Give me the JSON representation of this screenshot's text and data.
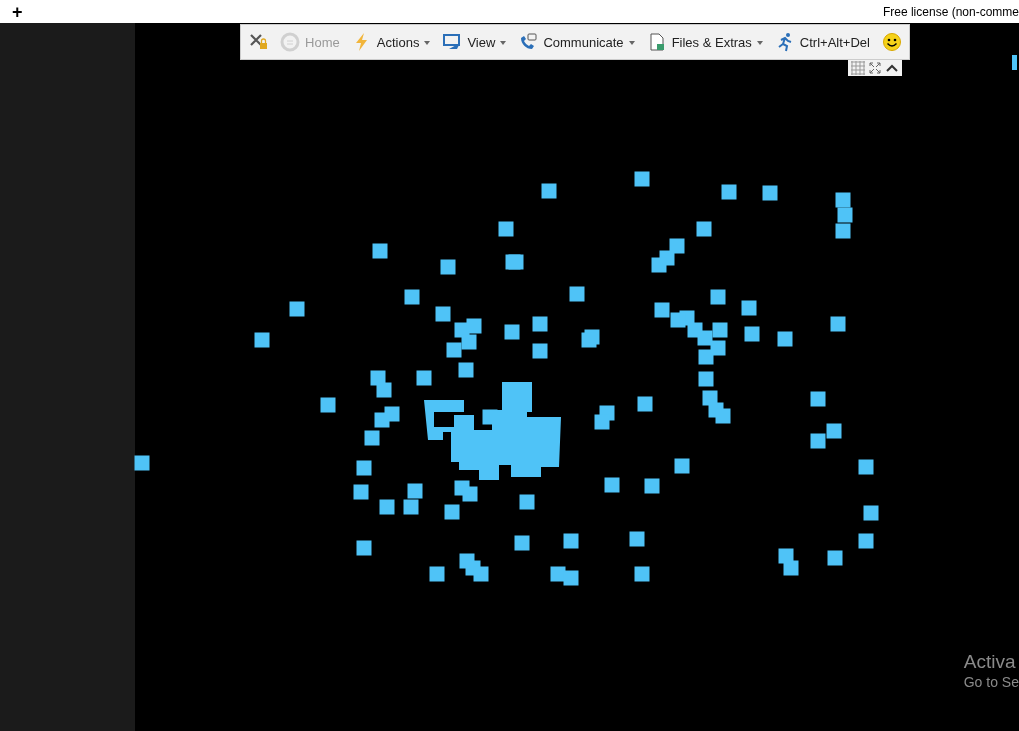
{
  "top_bar": {
    "add_button": "+",
    "license_text": "Free license (non-comme"
  },
  "toolbar": {
    "items": [
      {
        "disabled": false,
        "dropdown": false
      },
      {
        "label": "Home",
        "disabled": true,
        "dropdown": false
      },
      {
        "label": "Actions",
        "disabled": false,
        "dropdown": true
      },
      {
        "label": "View",
        "disabled": false,
        "dropdown": true
      },
      {
        "label": "Communicate",
        "disabled": false,
        "dropdown": true
      },
      {
        "label": "Files & Extras",
        "disabled": false,
        "dropdown": true
      },
      {
        "label": "Ctrl+Alt+Del",
        "disabled": false,
        "dropdown": false
      },
      {
        "disabled": false,
        "dropdown": false
      }
    ]
  },
  "activation_notice": {
    "title": "Activa",
    "subtitle": "Go to Se"
  }
}
